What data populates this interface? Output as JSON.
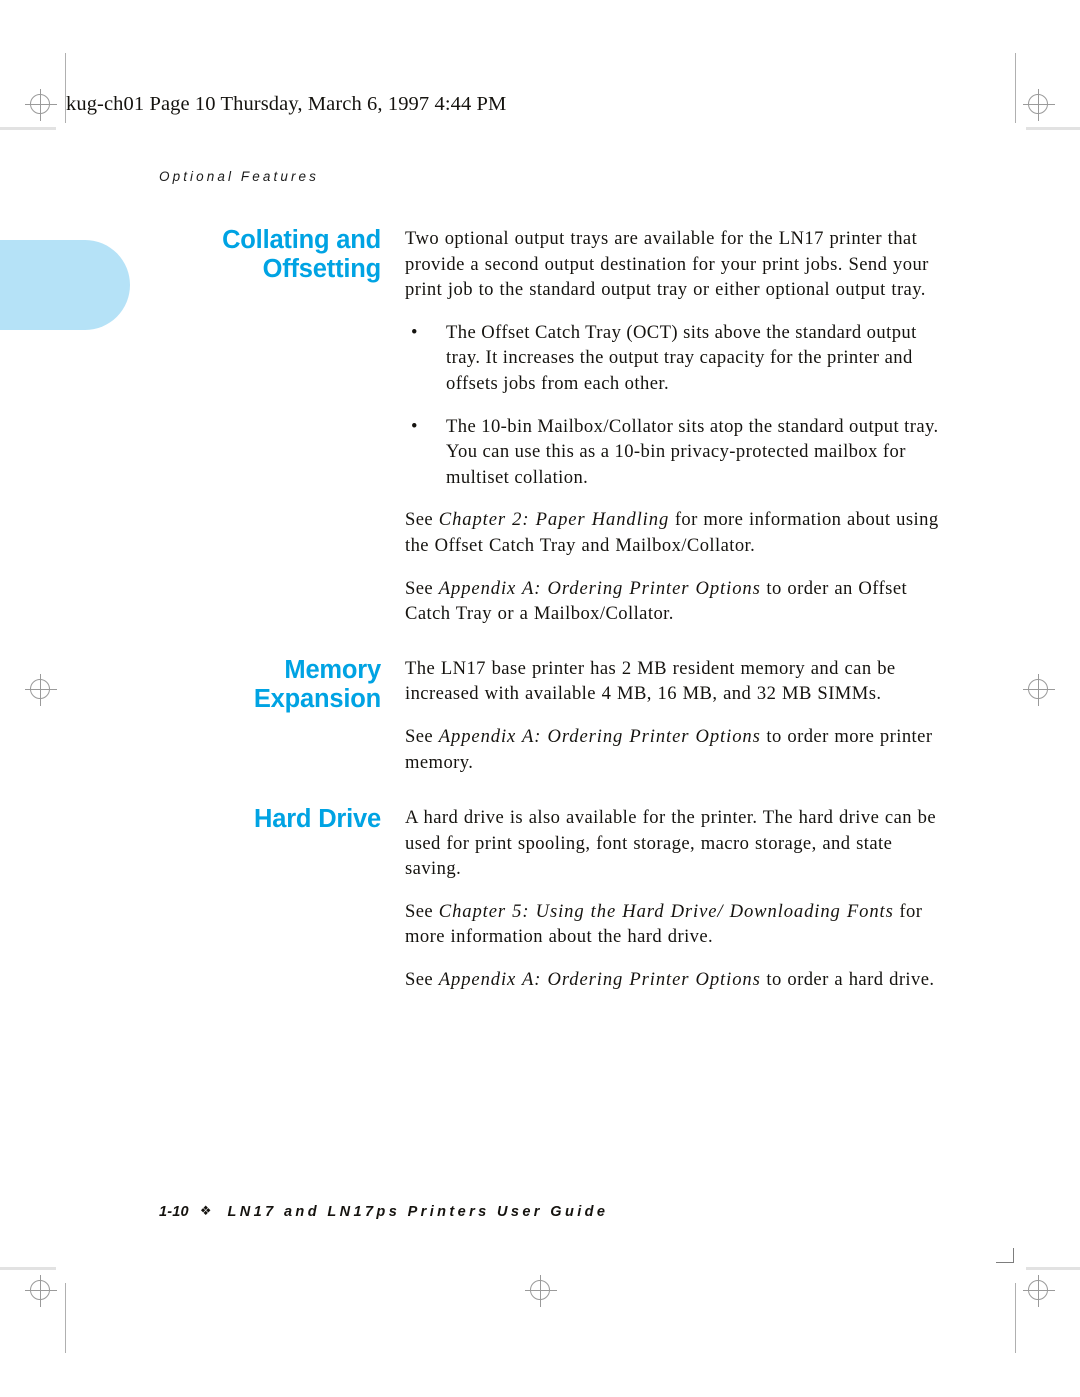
{
  "page": {
    "file_header": "kug-ch01  Page 10  Thursday, March 6, 1997  4:44 PM",
    "running_head": "Optional Features",
    "accent_color": "#00a3e3",
    "tab_color": "#b5e2f7",
    "bullet_glyph": "•"
  },
  "sections": [
    {
      "heading": "Collating and Offsetting",
      "intro": "Two optional output trays are available for the LN17 printer that provide a second output destination for your print jobs. Send your print job to the standard output tray or either optional output tray.",
      "bullets": [
        "The Offset Catch Tray (OCT) sits above the standard output tray. It increases the output tray capacity for the printer and offsets jobs from each other.",
        "The 10-bin Mailbox/Collator sits atop the standard output tray. You can use this as a 10-bin privacy-protected mailbox for multiset collation."
      ],
      "xrefs": [
        {
          "lead": "See ",
          "title": "Chapter 2: Paper Handling",
          "tail": " for more information about using the Offset Catch Tray and Mailbox/Collator."
        },
        {
          "lead": "See ",
          "title": "Appendix A: Ordering Printer Options",
          "tail": " to order an Offset Catch Tray or a Mailbox/Collator."
        }
      ]
    },
    {
      "heading": "Memory Expansion",
      "intro": "The LN17 base printer has 2 MB resident memory and can be increased with available 4 MB, 16 MB, and 32 MB SIMMs.",
      "bullets": [],
      "xrefs": [
        {
          "lead": "See ",
          "title": "Appendix A: Ordering Printer Options",
          "tail": " to order more printer memory."
        }
      ]
    },
    {
      "heading": "Hard Drive",
      "intro": "A hard drive is also available for the printer. The hard drive can be used for print spooling, font storage, macro storage, and state saving.",
      "bullets": [],
      "xrefs": [
        {
          "lead": "See ",
          "title": "Chapter 5: Using the Hard Drive/ Downloading Fonts",
          "tail": " for more information about the hard drive."
        },
        {
          "lead": "See ",
          "title": "Appendix A: Ordering Printer Options",
          "tail": " to order a hard drive."
        }
      ]
    }
  ],
  "footer": {
    "folio": "1-10",
    "separator": "❖",
    "book_title": "LN17 and LN17ps Printers User Guide"
  }
}
